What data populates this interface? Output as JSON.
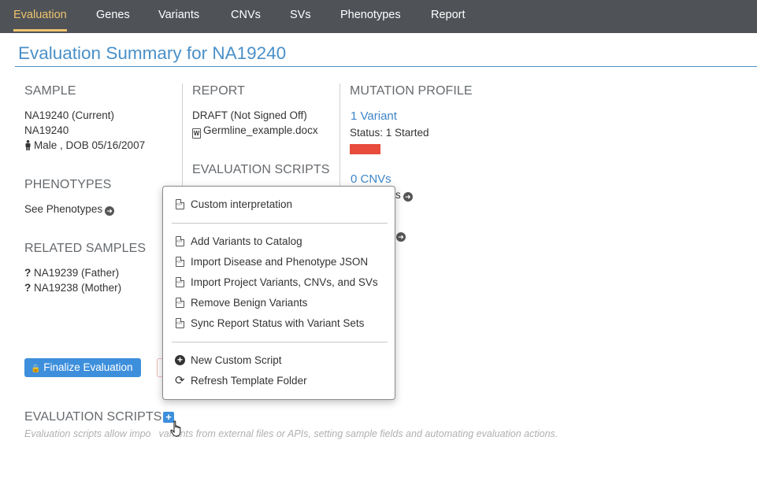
{
  "nav": {
    "tabs": [
      {
        "label": "Evaluation",
        "active": true
      },
      {
        "label": "Genes"
      },
      {
        "label": "Variants"
      },
      {
        "label": "CNVs"
      },
      {
        "label": "SVs"
      },
      {
        "label": "Phenotypes"
      },
      {
        "label": "Report"
      }
    ]
  },
  "page": {
    "title": "Evaluation Summary for NA19240"
  },
  "sample": {
    "heading": "SAMPLE",
    "current": "NA19240 (Current)",
    "name": "NA19240",
    "demographics": "Male , DOB 05/16/2007"
  },
  "phenotypes": {
    "heading": "PHENOTYPES",
    "link": "See Phenotypes"
  },
  "related": {
    "heading": "RELATED SAMPLES",
    "items": [
      {
        "prefix": "?",
        "label": "NA19239 (Father)"
      },
      {
        "prefix": "?",
        "label": "NA19238 (Mother)"
      }
    ]
  },
  "report": {
    "heading": "REPORT",
    "status": "DRAFT (Not Signed Off)",
    "file": "Germline_example.docx",
    "word_icon_letter": "W"
  },
  "eval_scripts_col": {
    "heading": "EVALUATION SCRIPTS"
  },
  "mutation": {
    "heading": "MUTATION PROFILE",
    "variants_link": "1 Variant",
    "variants_status": "Status: 1 Started",
    "status_color": "#e74c3c",
    "cnvs_link": "0 CNVs",
    "cnvs_partial": "s"
  },
  "buttons": {
    "finalize": "Finalize Evaluation",
    "lock_icon": "🔒"
  },
  "eval_scripts_section": {
    "heading": "EVALUATION SCRIPTS",
    "add_icon": "+",
    "help_before": "Evaluation scripts allow impo",
    "help_after": "variants from external files or APIs, setting sample fields and automating evaluation actions."
  },
  "menu": {
    "group1": [
      {
        "label": "Custom interpretation"
      }
    ],
    "group2": [
      {
        "label": "Add Variants to Catalog"
      },
      {
        "label": "Import Disease and Phenotype JSON"
      },
      {
        "label": "Import Project Variants, CNVs, and SVs"
      },
      {
        "label": "Remove Benign Variants"
      },
      {
        "label": "Sync Report Status with Variant Sets"
      }
    ],
    "group3": [
      {
        "label": "New Custom Script",
        "icon": "plus-circle-icon"
      },
      {
        "label": "Refresh Template Folder",
        "icon": "refresh-icon"
      }
    ]
  },
  "colors": {
    "nav_bg": "#4f5358",
    "nav_active": "#f0c36d",
    "title_blue": "#4a90c8",
    "button_blue": "#3d8fdc",
    "link_blue": "#3d85c6"
  }
}
